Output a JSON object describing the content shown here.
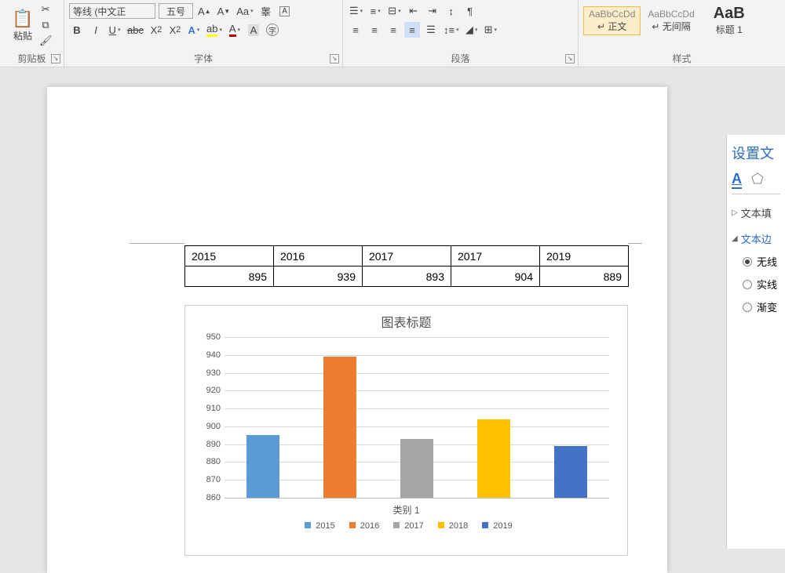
{
  "ribbon": {
    "clipboard": {
      "label": "剪贴板",
      "paste": "粘贴"
    },
    "font": {
      "label": "字体",
      "font_name": "等线 (中文正",
      "font_size": "五号"
    },
    "paragraph": {
      "label": "段落"
    },
    "styles": {
      "label": "样式",
      "items": [
        {
          "preview": "AaBbCcDd",
          "name": "↵ 正文"
        },
        {
          "preview": "AaBbCcDd",
          "name": "↵ 无间隔"
        },
        {
          "preview": "AaB",
          "name": "标题 1"
        }
      ]
    }
  },
  "table": {
    "headers": [
      "2015",
      "2016",
      "2017",
      "2017",
      "2019"
    ],
    "values": [
      "895",
      "939",
      "893",
      "904",
      "889"
    ]
  },
  "chart_data": {
    "type": "bar",
    "title": "图表标题",
    "xlabel": "类别 1",
    "ylim": [
      860,
      950
    ],
    "yticks": [
      860,
      870,
      880,
      890,
      900,
      910,
      920,
      930,
      940,
      950
    ],
    "series": [
      {
        "name": "2015",
        "value": 895,
        "color": "#5b9bd5"
      },
      {
        "name": "2016",
        "value": 939,
        "color": "#ed7d31"
      },
      {
        "name": "2017",
        "value": 893,
        "color": "#a5a5a5"
      },
      {
        "name": "2018",
        "value": 904,
        "color": "#ffc000"
      },
      {
        "name": "2019",
        "value": 889,
        "color": "#4472c4"
      }
    ]
  },
  "sidepane": {
    "title": "设置文",
    "section1": "文本填",
    "section2": "文本边",
    "options": [
      "无线",
      "实线",
      "渐变"
    ]
  }
}
